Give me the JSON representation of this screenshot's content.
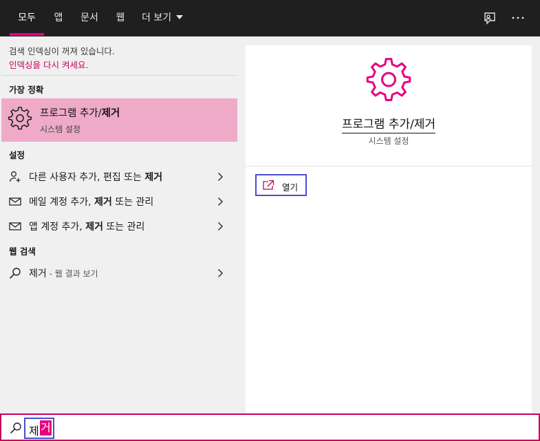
{
  "tabs": [
    {
      "label": "모두",
      "active": true
    },
    {
      "label": "앱"
    },
    {
      "label": "문서"
    },
    {
      "label": "웹"
    },
    {
      "label": "더 보기"
    }
  ],
  "topbar_icons": [
    "feedback-icon",
    "more-icon"
  ],
  "index_notice": {
    "text": "검색 인덱싱이 꺼져 있습니다.",
    "link": "인덱싱을 다시 켜세요."
  },
  "best_match": {
    "section": "가장 정확",
    "title_prefix": "프로그램 추가/",
    "title_bold": "제거",
    "subtitle": "시스템 설정",
    "icon": "gear-icon"
  },
  "settings": {
    "section": "설정",
    "items": [
      {
        "icon": "person-add-icon",
        "prefix": "다른 사용자 추가, 편집 또는 ",
        "bold": "제거",
        "suffix": ""
      },
      {
        "icon": "mail-icon",
        "prefix": "메일 계정 추가, ",
        "bold": "제거",
        "suffix": " 또는 관리"
      },
      {
        "icon": "mail-icon",
        "prefix": "앱 계정 추가, ",
        "bold": "제거",
        "suffix": " 또는 관리"
      }
    ]
  },
  "web": {
    "section": "웹 검색",
    "query": "제거",
    "suffix": " - 웹 결과 보기"
  },
  "preview": {
    "title": "프로그램 추가/제거",
    "subtitle": "시스템 설정",
    "open_label": "열기"
  },
  "search": {
    "query_part1": "제",
    "query_part2": "거"
  },
  "colors": {
    "accent": "#e6007e",
    "best_match_bg": "#eeaac7",
    "link": "#c4005d",
    "highlight_border": "#4a4ad0"
  }
}
